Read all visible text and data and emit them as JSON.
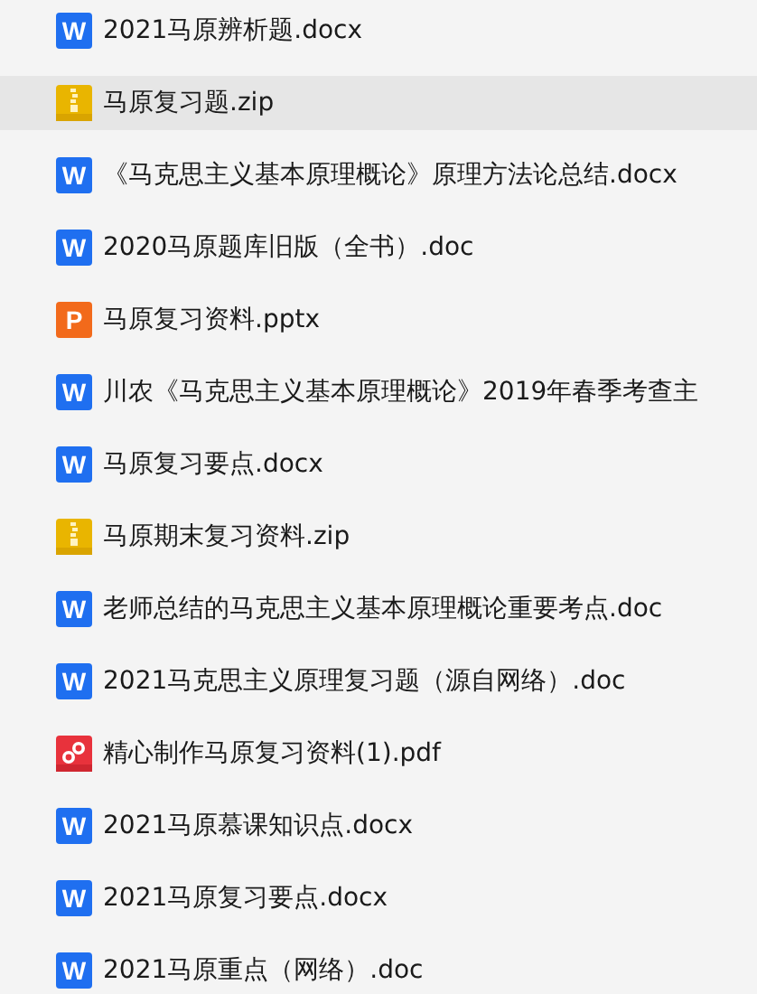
{
  "files": [
    {
      "kind": "doc",
      "icon_label": "W",
      "name": "2021马原辨析题.docx",
      "selected": false
    },
    {
      "kind": "zip",
      "name": "马原复习题.zip",
      "selected": true
    },
    {
      "kind": "doc",
      "icon_label": "W",
      "name": "《马克思主义基本原理概论》原理方法论总结.docx",
      "selected": false
    },
    {
      "kind": "doc",
      "icon_label": "W",
      "name": "2020马原题库旧版（全书）.doc",
      "selected": false
    },
    {
      "kind": "ppt",
      "icon_label": "P",
      "name": "马原复习资料.pptx",
      "selected": false
    },
    {
      "kind": "doc",
      "icon_label": "W",
      "name": "川农《马克思主义基本原理概论》2019年春季考查主",
      "selected": false
    },
    {
      "kind": "doc",
      "icon_label": "W",
      "name": "马原复习要点.docx",
      "selected": false
    },
    {
      "kind": "zip",
      "name": "马原期末复习资料.zip",
      "selected": false
    },
    {
      "kind": "doc",
      "icon_label": "W",
      "name": "老师总结的马克思主义基本原理概论重要考点.doc",
      "selected": false
    },
    {
      "kind": "doc",
      "icon_label": "W",
      "name": "2021马克思主义原理复习题（源自网络）.doc",
      "selected": false
    },
    {
      "kind": "pdf",
      "name": "精心制作马原复习资料(1).pdf",
      "selected": false
    },
    {
      "kind": "doc",
      "icon_label": "W",
      "name": "2021马原慕课知识点.docx",
      "selected": false
    },
    {
      "kind": "doc",
      "icon_label": "W",
      "name": "2021马原复习要点.docx",
      "selected": false
    },
    {
      "kind": "doc",
      "icon_label": "W",
      "name": "2021马原重点（网络）.doc",
      "selected": false
    }
  ]
}
